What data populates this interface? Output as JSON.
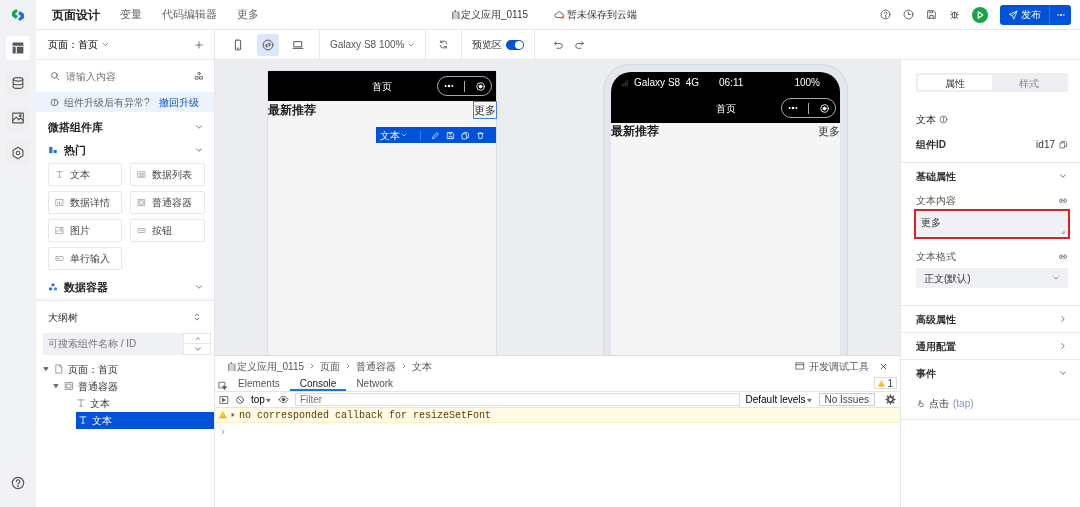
{
  "top_nav": {
    "tabs": [
      {
        "label": "页面设计",
        "selected": true
      },
      {
        "label": "变量",
        "selected": false
      },
      {
        "label": "代码编辑器",
        "selected": false
      },
      {
        "label": "更多",
        "selected": false
      }
    ],
    "app_name": "自定义应用_0115",
    "save_status": "暂未保存到云端",
    "publish_button": "发布"
  },
  "page_selector": "页面：首页",
  "toolbar": {
    "devices": [
      {
        "kind": "phone",
        "selected": false
      },
      {
        "kind": "miniprogram",
        "selected": true
      },
      {
        "kind": "desktop",
        "selected": false
      }
    ],
    "device_model": "Galaxy S8 100%",
    "preview_label": "预览区",
    "preview_on": true
  },
  "sidebar": {
    "rail": [
      {
        "kind": "pages",
        "selected": true
      },
      {
        "kind": "data",
        "selected": false
      },
      {
        "kind": "media",
        "selected": false
      },
      {
        "kind": "settings",
        "selected": false
      }
    ],
    "search_placeholder": "请输入内容",
    "notice": "组件升级后有异常?",
    "notice_link": "撤回升级",
    "library_title": "微搭组件库",
    "groups": [
      {
        "title": "热门",
        "kind": "hot",
        "expanded": true,
        "components": [
          {
            "label": "文本",
            "kind": "text"
          },
          {
            "label": "数据列表",
            "kind": "list"
          },
          {
            "label": "数据详情",
            "kind": "detail"
          },
          {
            "label": "普通容器",
            "kind": "container"
          },
          {
            "label": "图片",
            "kind": "image"
          },
          {
            "label": "按钮",
            "kind": "button"
          },
          {
            "label": "单行输入",
            "kind": "input"
          }
        ]
      },
      {
        "title": "数据容器",
        "kind": "data",
        "expanded": true
      }
    ]
  },
  "outline": {
    "title": "大纲树",
    "search_placeholder": "可搜索组件名称 / ID",
    "tree": [
      {
        "label": "页面：首页",
        "kind": "page",
        "expanded": true,
        "selected": false,
        "children": [
          {
            "label": "普通容器",
            "kind": "container",
            "expanded": true,
            "selected": false,
            "children": [
              {
                "label": "文本",
                "kind": "text",
                "selected": false
              },
              {
                "label": "文本",
                "kind": "text",
                "selected": true
              }
            ]
          }
        ]
      }
    ]
  },
  "canvas": {
    "editor": {
      "nav_title": "首页",
      "heading": "最新推荐",
      "link": "更多",
      "toolbar_label": "文本"
    },
    "preview": {
      "carrier": "Galaxy S8  4G",
      "time": "06:11",
      "battery": "100%",
      "nav_title": "首页",
      "heading": "最新推荐",
      "link": "更多"
    }
  },
  "devtools": {
    "breadcrumb": [
      "自定义应用_0115",
      "页面",
      "普通容器",
      "文本"
    ],
    "title": "开发调试工具",
    "tabs": [
      {
        "label": "Elements",
        "selected": false
      },
      {
        "label": "Console",
        "selected": true
      },
      {
        "label": "Network",
        "selected": false
      }
    ],
    "warning_count": "1",
    "context": "top",
    "filter_placeholder": "Filter",
    "levels": "Default levels",
    "issues": "No Issues",
    "messages": [
      {
        "kind": "warning",
        "text": "no corresponded callback for resizeSetFont"
      }
    ]
  },
  "properties": {
    "tabs": [
      {
        "label": "属性",
        "selected": true
      },
      {
        "label": "样式",
        "selected": false
      }
    ],
    "component_title": "文本",
    "id_label": "组件ID",
    "id_value": "id17",
    "basic": {
      "title": "基础属性",
      "expanded": true,
      "content_label": "文本内容",
      "content_value": "更多",
      "content_highlighted": true,
      "format_label": "文本格式",
      "format_value": "正文(默认)"
    },
    "advanced": {
      "title": "高级属性",
      "expanded": false
    },
    "common": {
      "title": "通用配置",
      "expanded": false
    },
    "events": {
      "title": "事件",
      "expanded": true,
      "items": [
        {
          "label": "点击",
          "event": "(tap)"
        }
      ]
    }
  }
}
